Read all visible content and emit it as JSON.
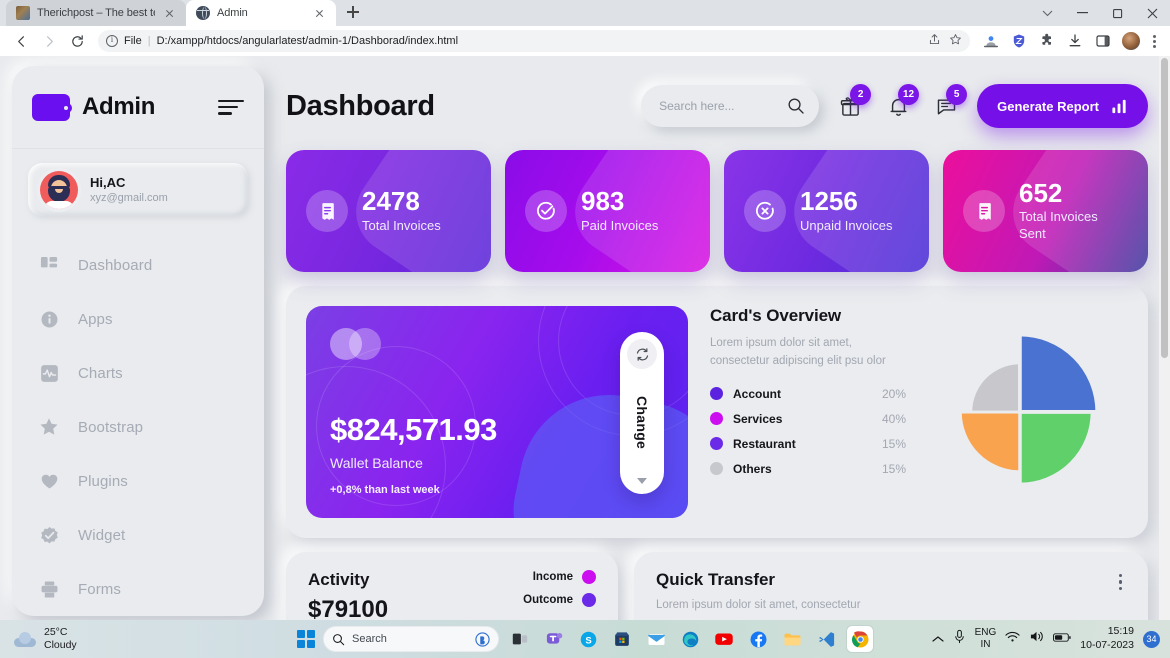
{
  "browser": {
    "tabs": [
      {
        "title": "Therichpost – The best tech and",
        "favicon": "image-favicon",
        "active": false
      },
      {
        "title": "Admin",
        "favicon": "globe-favicon",
        "active": true
      }
    ],
    "new_tab_label": "+",
    "omnibox": {
      "scheme_label": "File",
      "separator": "|",
      "url": "D:/xampp/htdocs/angularlatest/admin-1/Dashborad/index.html"
    },
    "window_controls": [
      "tab-search",
      "minimize",
      "maximize",
      "close"
    ],
    "toolbar_icons": [
      "back",
      "forward",
      "reload",
      "share",
      "bookmark-star",
      "profile-scan",
      "shield",
      "extensions",
      "download",
      "side-panel",
      "avatar",
      "menu"
    ]
  },
  "sidebar": {
    "brand": "Admin",
    "logo": "wallet-icon",
    "menu_icon": "hamburger-icon",
    "profile": {
      "greeting": "Hi,AC",
      "email": "xyz@gmail.com"
    },
    "items": [
      {
        "label": "Dashboard",
        "icon": "grid-icon"
      },
      {
        "label": "Apps",
        "icon": "info-icon"
      },
      {
        "label": "Charts",
        "icon": "activity-chart-icon"
      },
      {
        "label": "Bootstrap",
        "icon": "star-icon"
      },
      {
        "label": "Plugins",
        "icon": "heart-icon"
      },
      {
        "label": "Widget",
        "icon": "badge-check-icon"
      },
      {
        "label": "Forms",
        "icon": "printer-icon"
      }
    ]
  },
  "header": {
    "title": "Dashboard",
    "search": {
      "placeholder": "Search here...",
      "value": ""
    },
    "actions": [
      {
        "icon": "gift-icon",
        "badge": "2"
      },
      {
        "icon": "bell-icon",
        "badge": "12"
      },
      {
        "icon": "chat-icon",
        "badge": "5"
      }
    ],
    "generate_report": {
      "label": "Generate Report",
      "icon": "bar-chart-icon"
    }
  },
  "stats": [
    {
      "value": "2478",
      "label": "Total Invoices",
      "icon": "invoice-icon",
      "color": "#7a27e0"
    },
    {
      "value": "983",
      "label": "Paid Invoices",
      "icon": "check-circle-icon",
      "color": "#a50cec"
    },
    {
      "value": "1256",
      "label": "Unpaid Invoices",
      "icon": "x-circle-icon",
      "color": "#6f2ae0"
    },
    {
      "value": "652",
      "label": "Total Invoices Sent",
      "icon": "invoice-icon",
      "color": "#ec0f9c"
    }
  ],
  "wallet": {
    "amount": "$824,571.93",
    "label": "Wallet Balance",
    "delta": "+0,8% than last week",
    "change_button": {
      "label": "Change",
      "icon": "refresh-icon",
      "caret": "chevron-down-icon"
    }
  },
  "overview": {
    "title": "Card's Overview",
    "description": "Lorem ipsum dolor sit amet, consectetur adipiscing elit psu olor"
  },
  "activity": {
    "title": "Activity",
    "amount": "$79100",
    "legends": [
      {
        "label": "Income",
        "color": "#cc0df0"
      },
      {
        "label": "Outcome",
        "color": "#6a2ae8"
      }
    ]
  },
  "quick_transfer": {
    "title": "Quick Transfer",
    "description": "Lorem ipsum dolor sit amet, consectetur",
    "menu_icon": "vertical-dots-icon"
  },
  "taskbar": {
    "weather": {
      "temp": "25°C",
      "condition": "Cloudy",
      "icon": "cloud-icon"
    },
    "start_label": "start-button",
    "search": {
      "placeholder": "Search",
      "icon": "search-icon",
      "assistant": "copilot-icon"
    },
    "apps": [
      "task-view",
      "teams",
      "skype",
      "microsoft-store",
      "mail",
      "edge",
      "youtube",
      "facebook",
      "file-explorer",
      "vs-code",
      "chrome"
    ],
    "tray": {
      "overflow": "chevron-up-icon",
      "mic": "microphone-icon",
      "language_line1": "ENG",
      "language_line2": "IN",
      "wifi": "wifi-icon",
      "volume": "speaker-icon",
      "battery": "battery-icon",
      "time": "15:19",
      "date": "10-07-2023",
      "notification_count": "34"
    }
  },
  "chart_data": {
    "type": "pie",
    "title": "Card's Overview",
    "variant": "variable-radius-quadrants",
    "categories": [
      "Account",
      "Services",
      "Restaurant",
      "Others"
    ],
    "values": [
      20,
      40,
      15,
      15
    ],
    "labels": [
      "20%",
      "40%",
      "15%",
      "15%"
    ],
    "legend_colors": [
      "#5b23e0",
      "#cc0df0",
      "#6a2ae8",
      "#c6c8cd"
    ],
    "slice_colors": [
      "#4a72d0",
      "#5fd06a",
      "#f9a košice",
      "#c8c8cc"
    ],
    "slices": [
      {
        "name": "Account",
        "percent": 20,
        "quadrant": "top-right",
        "color": "#4a72d0",
        "radius": 0.98
      },
      {
        "name": "Services",
        "percent": 40,
        "quadrant": "bottom-right",
        "color": "#5fd06a",
        "radius": 0.92
      },
      {
        "name": "Restaurant",
        "percent": 15,
        "quadrant": "bottom-left",
        "color": "#f9a council",
        "radius": 0.76
      },
      {
        "name": "Others",
        "percent": 15,
        "quadrant": "top-left",
        "color": "#c8c8cc",
        "radius": 0.62
      }
    ],
    "legend_position": "left",
    "grid": false
  }
}
